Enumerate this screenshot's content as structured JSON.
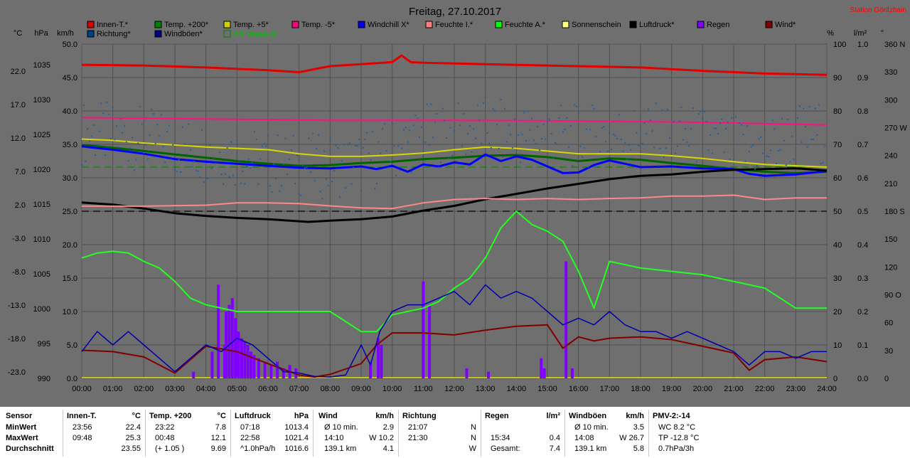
{
  "title": "Freitag, 27.10.2017",
  "station": "Station Göritzhain",
  "colors": {
    "background": "#6f6f6f",
    "grid": "#4f4f4f",
    "axis_text": "#000000",
    "baseline": "#e6e000"
  },
  "legend": [
    {
      "label": "Innen-T.*",
      "color": "#e00000"
    },
    {
      "label": "Temp. +200*",
      "color": "#008000"
    },
    {
      "label": "Temp. +5*",
      "color": "#d0d000"
    },
    {
      "label": "Temp. -5*",
      "color": "#ff0080"
    },
    {
      "label": "Windchill X*",
      "color": "#0000ff"
    },
    {
      "label": "Feuchte I.*",
      "color": "#ff8080"
    },
    {
      "label": "Feuchte A.*",
      "color": "#00ff00"
    },
    {
      "label": "Sonnenschein",
      "color": "#ffff80"
    },
    {
      "label": "Luftdruck*",
      "color": "#000000"
    },
    {
      "label": "Regen",
      "color": "#8000ff"
    },
    {
      "label": "Wind*",
      "color": "#800000"
    },
    {
      "label": "Richtung*",
      "color": "#004080"
    },
    {
      "label": "Windböen*",
      "color": "#000080"
    },
    {
      "label": "8.6 Monat-Ø",
      "color": "#008000",
      "text_color": "#00c000",
      "outline": true
    }
  ],
  "axes": {
    "temp": {
      "unit": "°C",
      "ticks": [
        "22.0",
        "17.0",
        "12.0",
        "7.0",
        "2.0",
        "-3.0",
        "-8.0",
        "-13.0",
        "-18.0",
        "-23.0"
      ]
    },
    "pressure": {
      "unit": "hPa",
      "ticks": [
        "1035",
        "1030",
        "1025",
        "1020",
        "1015",
        "1010",
        "1005",
        "1000",
        "995",
        "990"
      ]
    },
    "wind": {
      "unit": "km/h",
      "ticks": [
        "50.0",
        "45.0",
        "40.0",
        "35.0",
        "30.0",
        "25.0",
        "20.0",
        "15.0",
        "10.0",
        "5.0",
        "0.0"
      ]
    },
    "humidity": {
      "unit": "%",
      "ticks": [
        "100",
        "90",
        "80",
        "70",
        "60",
        "50",
        "40",
        "30",
        "20",
        "10",
        "0"
      ]
    },
    "rain": {
      "unit": "l/m²",
      "ticks": [
        "1.0",
        "0.9",
        "0.8",
        "0.7",
        "0.6",
        "0.5",
        "0.4",
        "0.3",
        "0.2",
        "0.1",
        "0.0"
      ]
    },
    "direction": {
      "unit": "°",
      "ticks": [
        "360 N",
        "330",
        "300",
        "270 W",
        "240",
        "210",
        "180 S",
        "150",
        "120",
        "90 O",
        "60",
        "30",
        "0"
      ]
    },
    "time": {
      "ticks": [
        "00:00",
        "01:00",
        "02:00",
        "03:00",
        "04:00",
        "05:00",
        "06:00",
        "07:00",
        "08:00",
        "09:00",
        "10:00",
        "11:00",
        "12:00",
        "13:00",
        "14:00",
        "15:00",
        "16:00",
        "17:00",
        "18:00",
        "19:00",
        "20:00",
        "21:00",
        "22:00",
        "23:00",
        "24:00"
      ]
    }
  },
  "chart_data": {
    "type": "line",
    "title": "Freitag, 27.10.2017",
    "x_unit": "hours",
    "xlim": [
      0,
      24
    ],
    "axes_ranges": {
      "temp_c": [
        -23,
        27
      ],
      "pressure_hpa": [
        990,
        1040
      ],
      "wind_kmh": [
        0,
        50
      ],
      "humidity_pct": [
        0,
        100
      ],
      "rain_lm2": [
        0,
        1
      ],
      "direction_deg": [
        0,
        360
      ]
    },
    "grid": true,
    "series": [
      {
        "name": "Innen-T.*",
        "axis": "temp_c",
        "color": "#e00000",
        "width": 3,
        "x": [
          0,
          2,
          4,
          6,
          7,
          8,
          9,
          10,
          10.3,
          10.6,
          11,
          13,
          15,
          18,
          20,
          22,
          24
        ],
        "y": [
          23.9,
          23.8,
          23.5,
          23.1,
          22.8,
          23.7,
          24.0,
          24.3,
          25.3,
          24.3,
          24.2,
          24.0,
          23.8,
          23.5,
          23.0,
          22.6,
          22.4
        ]
      },
      {
        "name": "Temp. -5*",
        "axis": "temp_c",
        "color": "#ff1080",
        "width": 2,
        "x": [
          0,
          4,
          8,
          12,
          16,
          20,
          24
        ],
        "y": [
          16.0,
          15.8,
          15.6,
          15.6,
          15.5,
          15.3,
          14.9
        ]
      },
      {
        "name": "Temp. +5*",
        "axis": "temp_c",
        "color": "#d8d800",
        "width": 2,
        "x": [
          0,
          1,
          2,
          3,
          4,
          5,
          6,
          7,
          8,
          9,
          10,
          11,
          12,
          13,
          14,
          15,
          16,
          17,
          18,
          19,
          20,
          21,
          22,
          23,
          24
        ],
        "y": [
          12.8,
          12.6,
          12.2,
          11.9,
          11.6,
          11.4,
          11.2,
          10.6,
          10.2,
          10.2,
          10.4,
          10.7,
          11.2,
          11.6,
          11.4,
          11.0,
          10.6,
          10.6,
          10.6,
          10.3,
          9.9,
          9.4,
          9.0,
          8.8,
          8.6
        ]
      },
      {
        "name": "Temp. +200*",
        "axis": "temp_c",
        "color": "#006400",
        "width": 3,
        "x": [
          0,
          1,
          2,
          3,
          4,
          5,
          6,
          7,
          8,
          9,
          10,
          11,
          12,
          13,
          14,
          15,
          16,
          17,
          18,
          19,
          20,
          21,
          22,
          23,
          24
        ],
        "y": [
          11.9,
          11.5,
          11.0,
          10.5,
          10.0,
          9.5,
          9.1,
          8.8,
          8.9,
          9.2,
          9.4,
          9.8,
          10.0,
          10.3,
          10.4,
          10.1,
          9.5,
          9.9,
          9.7,
          9.2,
          8.8,
          8.3,
          7.9,
          7.7,
          7.9
        ]
      },
      {
        "name": "Windchill X*",
        "axis": "temp_c",
        "color": "#0000ff",
        "width": 3,
        "x": [
          0,
          1,
          2,
          3,
          4,
          5,
          6,
          7,
          8,
          9,
          9.5,
          10,
          10.5,
          11,
          11.5,
          12,
          12.5,
          13,
          13.5,
          14,
          14.5,
          15,
          15.5,
          16,
          16.5,
          17,
          17.5,
          18,
          19,
          20,
          21,
          21.5,
          22,
          23,
          24
        ],
        "y": [
          11.7,
          11.2,
          10.6,
          9.8,
          9.4,
          9.1,
          8.8,
          8.5,
          8.4,
          8.7,
          8.3,
          8.8,
          7.9,
          9.0,
          8.7,
          9.3,
          9.0,
          10.5,
          9.5,
          10.2,
          9.7,
          8.7,
          7.7,
          7.8,
          8.9,
          9.6,
          9.1,
          8.6,
          8.7,
          8.4,
          8.3,
          7.6,
          7.3,
          7.5,
          8.0
        ]
      },
      {
        "name": "Luftdruck*",
        "axis": "pressure_hpa",
        "color": "#000000",
        "width": 3,
        "x": [
          0,
          1,
          2,
          3,
          4,
          5,
          6,
          7,
          7.3,
          8,
          9,
          10,
          11,
          12,
          13,
          14,
          15,
          16,
          17,
          18,
          19,
          20,
          21,
          22,
          23,
          24
        ],
        "y": [
          1016.3,
          1016.0,
          1015.4,
          1014.7,
          1014.3,
          1014.0,
          1013.8,
          1013.5,
          1013.4,
          1013.6,
          1013.8,
          1014.2,
          1015.1,
          1015.8,
          1016.8,
          1017.6,
          1018.4,
          1019.1,
          1019.8,
          1020.3,
          1020.5,
          1020.9,
          1021.2,
          1021.3,
          1021.4,
          1021.1
        ]
      },
      {
        "name": "Feuchte I.*",
        "axis": "humidity_pct",
        "color": "#ff8888",
        "width": 2,
        "x": [
          0,
          2,
          4,
          5,
          6,
          7,
          8,
          9,
          10,
          11,
          12,
          13,
          14,
          15,
          16,
          17,
          18,
          19,
          20,
          21,
          22,
          23,
          24
        ],
        "y": [
          51.5,
          51.5,
          51.8,
          52.5,
          52.5,
          52.3,
          51.6,
          51.0,
          50.8,
          52.5,
          53.5,
          53.8,
          53.5,
          53.8,
          53.5,
          53.8,
          54.0,
          54.5,
          54.5,
          54.8,
          53.5,
          54.0,
          54.0
        ]
      },
      {
        "name": "Feuchte A.*",
        "axis": "humidity_pct",
        "color": "#22ff22",
        "width": 2,
        "x": [
          0,
          0.5,
          1,
          1.5,
          2,
          2.5,
          3,
          3.5,
          4,
          5,
          6,
          7,
          8,
          9,
          9.5,
          10,
          11,
          11.5,
          12,
          12.5,
          13,
          13.5,
          14,
          14.5,
          15,
          15.5,
          16,
          16.5,
          17,
          18,
          19,
          20,
          21,
          22,
          23,
          24
        ],
        "y": [
          36,
          37.5,
          38,
          37.5,
          35,
          33,
          29,
          24,
          22,
          20,
          20,
          20,
          20,
          14,
          14,
          19,
          21,
          23,
          27,
          30,
          36,
          45,
          50,
          46,
          44,
          41,
          32,
          21,
          35,
          33,
          32,
          31,
          29,
          27,
          21,
          21
        ]
      },
      {
        "name": "Wind*",
        "axis": "wind_kmh",
        "color": "#800000",
        "width": 2,
        "x": [
          0,
          1,
          2,
          3,
          4,
          5,
          6,
          7,
          7.5,
          8,
          9,
          9.5,
          10,
          11,
          12,
          13,
          14,
          15,
          15.5,
          16,
          16.5,
          17,
          18,
          19,
          20,
          21,
          21.5,
          22,
          23,
          24
        ],
        "y": [
          4.2,
          4.0,
          3.2,
          0.8,
          4.8,
          4.0,
          2.2,
          0.5,
          0.2,
          0.6,
          2.2,
          5.0,
          6.8,
          6.8,
          6.5,
          7.2,
          7.8,
          8.0,
          4.5,
          6.2,
          5.6,
          6.0,
          6.2,
          5.8,
          4.8,
          3.8,
          1.2,
          2.8,
          3.2,
          2.5
        ]
      },
      {
        "name": "Windböen*",
        "axis": "wind_kmh",
        "color": "#0000aa",
        "width": 1.5,
        "x": [
          0,
          0.5,
          1,
          1.5,
          2,
          2.5,
          3,
          3.5,
          4,
          4.5,
          5,
          5.5,
          6,
          6.5,
          7,
          7.5,
          8,
          8.5,
          9,
          9.3,
          9.6,
          10,
          10.5,
          11,
          11.5,
          12,
          12.5,
          13,
          13.5,
          14,
          14.5,
          15,
          15.5,
          16,
          16.5,
          17,
          17.5,
          18,
          18.5,
          19,
          19.5,
          20,
          20.5,
          21,
          21.5,
          22,
          22.5,
          23,
          23.5,
          24
        ],
        "y": [
          4,
          7,
          5,
          7,
          5,
          3,
          1,
          3,
          5,
          4,
          6,
          5,
          3,
          1,
          0.8,
          0.3,
          0.2,
          0.5,
          5,
          2,
          7,
          10,
          11,
          11,
          12,
          13,
          11,
          14,
          12,
          13,
          12,
          10,
          8,
          9,
          8,
          10,
          8,
          7,
          7,
          6,
          7,
          6,
          5,
          4,
          2,
          4,
          4,
          3,
          4,
          4
        ]
      },
      {
        "name": "Richtung*",
        "axis": "direction_deg",
        "type": "scatter",
        "color": "#1e5fa0",
        "x": [
          0,
          1,
          2,
          3,
          4,
          5,
          6,
          7,
          8,
          9,
          10,
          11,
          12,
          13,
          14,
          15,
          16,
          17,
          18,
          19,
          20,
          21,
          22,
          23,
          24
        ],
        "y": [
          265,
          262,
          258,
          250,
          245,
          240,
          232,
          230,
          228,
          232,
          246,
          262,
          262,
          270,
          262,
          265,
          260,
          262,
          262,
          262,
          258,
          248,
          247,
          262,
          265
        ]
      },
      {
        "name": "8.6 Monat-Ø",
        "axis": "temp_c",
        "type": "dashed",
        "color": "#008000",
        "y": 8.6
      },
      {
        "name": "Temp. 0 ref",
        "axis": "temp_c",
        "type": "dashed",
        "color": "#000000",
        "y": 0.5,
        "label": ""
      }
    ],
    "rain_bars": {
      "name": "Regen",
      "axis": "rain_lm2",
      "color": "#8000ff",
      "x": [
        3.6,
        4.2,
        4.4,
        4.6,
        4.65,
        4.75,
        4.85,
        4.95,
        5.05,
        5.15,
        5.25,
        5.35,
        5.45,
        5.55,
        5.7,
        5.9,
        6.1,
        6.3,
        6.5,
        6.7,
        6.9,
        9.3,
        9.55,
        9.65,
        11.0,
        11.2,
        12.4,
        13.1,
        14.8,
        14.9,
        15.6,
        15.8
      ],
      "y": [
        0.02,
        0.08,
        0.28,
        0.1,
        0.2,
        0.22,
        0.24,
        0.18,
        0.14,
        0.12,
        0.11,
        0.1,
        0.08,
        0.07,
        0.06,
        0.05,
        0.04,
        0.05,
        0.03,
        0.04,
        0.03,
        0.05,
        0.12,
        0.1,
        0.29,
        0.22,
        0.03,
        0.02,
        0.06,
        0.03,
        0.35,
        0.03
      ]
    },
    "reference_lines": [
      {
        "name": "8.6 Monat-Ø",
        "axis": "temp_c",
        "value": 8.6,
        "style": "dashed",
        "color": "#008000"
      },
      {
        "name": "humidity 50",
        "axis": "humidity_pct",
        "value": 50,
        "style": "dashed",
        "color": "#000000"
      }
    ]
  },
  "stats": {
    "row_labels": [
      "Sensor",
      "MinWert",
      "MaxWert",
      "Durchschnitt"
    ],
    "columns": [
      {
        "name": "Innen-T.",
        "unit": "°C",
        "rows": [
          [
            "23:56",
            "22.4"
          ],
          [
            "09:48",
            "25.3"
          ],
          [
            "",
            "23.55"
          ]
        ]
      },
      {
        "name": "Temp. +200",
        "unit": "°C",
        "rows": [
          [
            "23:22",
            "7.8"
          ],
          [
            "00:48",
            "12.1"
          ],
          [
            "(+ 1.05 )",
            "9.69"
          ]
        ]
      },
      {
        "name": "Luftdruck",
        "unit": "hPa",
        "rows": [
          [
            "07:18",
            "1013.4"
          ],
          [
            "22:58",
            "1021.4"
          ],
          [
            "^1.0hPa/h",
            "1016.6"
          ]
        ]
      },
      {
        "name": "Wind",
        "unit": "km/h",
        "rows": [
          [
            "Ø 10 min.",
            "2.9"
          ],
          [
            "14:10",
            "W 10.2"
          ],
          [
            "139.1 km",
            "4.1"
          ]
        ]
      },
      {
        "name": "Richtung",
        "unit": "",
        "rows": [
          [
            "21:07",
            "N"
          ],
          [
            "21:30",
            "N"
          ],
          [
            "",
            "W"
          ]
        ]
      },
      {
        "name": "Regen",
        "unit": "l/m²",
        "rows": [
          [
            "",
            ""
          ],
          [
            "15:34",
            "0.4"
          ],
          [
            "Gesamt:",
            "7.4"
          ]
        ]
      },
      {
        "name": "Windböen",
        "unit": "km/h",
        "rows": [
          [
            "Ø 10 min.",
            "3.5"
          ],
          [
            "14:08",
            "W 26.7"
          ],
          [
            "139.1 km",
            "5.8"
          ]
        ]
      },
      {
        "name": "PMV-2:-14",
        "unit": "",
        "rows": [
          [
            "WC 8.2 °C",
            ""
          ],
          [
            "TP -12.8 °C",
            ""
          ],
          [
            "0.7hPa/3h",
            ""
          ]
        ]
      }
    ]
  }
}
